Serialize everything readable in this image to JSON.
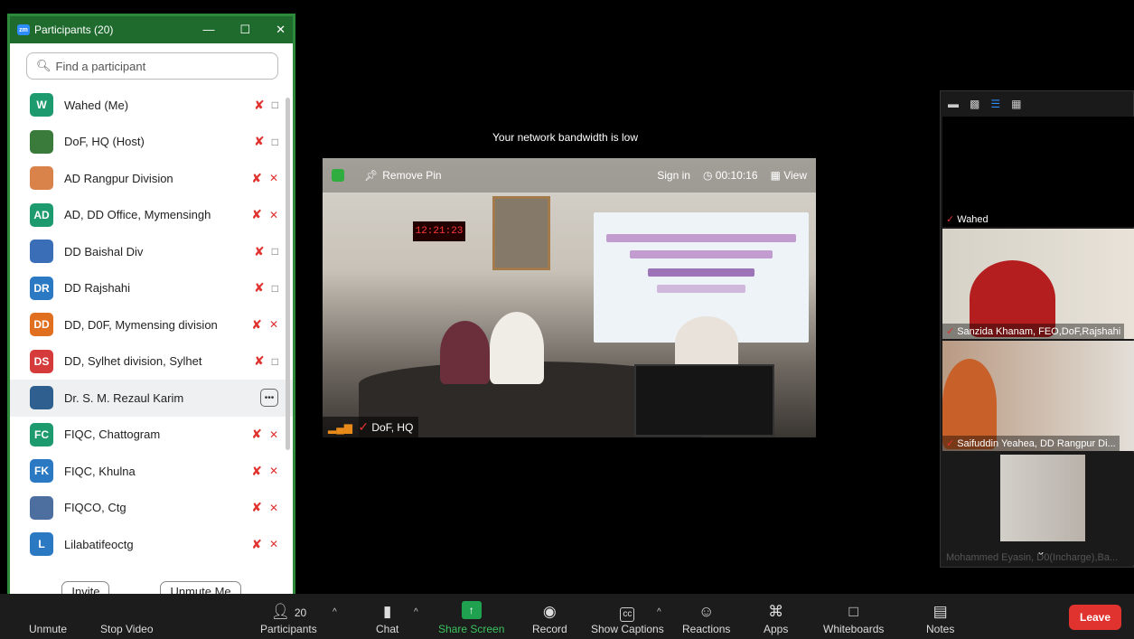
{
  "panel": {
    "title": "Participants (20)",
    "logo": "zm",
    "search_placeholder": "Find a participant",
    "invite_label": "Invite",
    "unmute_me_label": "Unmute Me",
    "participants": [
      {
        "name": "Wahed (Me)",
        "initials": "W",
        "color": "#1e9a6f",
        "mic": "muted",
        "video": "on"
      },
      {
        "name": "DoF, HQ (Host)",
        "initials": "",
        "color": "#3a7a3a",
        "mic": "muted",
        "video": "on"
      },
      {
        "name": "AD Rangpur Division",
        "initials": "",
        "color": "#d9824a",
        "mic": "muted",
        "video": "off"
      },
      {
        "name": "AD, DD Office, Mymensingh",
        "initials": "AD",
        "color": "#1e9a6f",
        "mic": "muted",
        "video": "off"
      },
      {
        "name": "DD Baishal Div",
        "initials": "",
        "color": "#3a6fb7",
        "mic": "muted",
        "video": "on"
      },
      {
        "name": "DD Rajshahi",
        "initials": "DR",
        "color": "#2b79c2",
        "mic": "muted",
        "video": "on"
      },
      {
        "name": "DD, D0F, Mymensing division",
        "initials": "DD",
        "color": "#e07020",
        "mic": "muted",
        "video": "off"
      },
      {
        "name": "DD, Sylhet division, Sylhet",
        "initials": "DS",
        "color": "#d63b3b",
        "mic": "muted",
        "video": "on"
      },
      {
        "name": "Dr. S. M. Rezaul Karim",
        "initials": "",
        "color": "#2f5f8f",
        "mic": "none",
        "video": "more"
      },
      {
        "name": "FIQC, Chattogram",
        "initials": "FC",
        "color": "#1e9a6f",
        "mic": "muted",
        "video": "off"
      },
      {
        "name": "FIQC, Khulna",
        "initials": "FK",
        "color": "#2b79c2",
        "mic": "muted",
        "video": "off"
      },
      {
        "name": "FIQCO, Ctg",
        "initials": "",
        "color": "#4d6f9f",
        "mic": "muted",
        "video": "off"
      },
      {
        "name": "Lilabatifeoctg",
        "initials": "L",
        "color": "#2b79c2",
        "mic": "muted",
        "video": "off"
      }
    ]
  },
  "network_message": "Your network bandwidth is low",
  "main_video": {
    "remove_pin": "Remove Pin",
    "sign_in": "Sign in",
    "timer": "00:10:16",
    "view": "View",
    "speaker_label": "DoF, HQ",
    "clock": "12:21:23"
  },
  "gallery": {
    "tiles": [
      {
        "name": "Wahed"
      },
      {
        "name": "Sanzida Khanam, FEO,DoF,Rajshahi"
      },
      {
        "name": "Saifuddin Yeahea, DD Rangpur Di..."
      },
      {
        "name": "Mohammed Eyasin, D0(Incharge),Ba..."
      }
    ]
  },
  "toolbar": {
    "unmute": "Unmute",
    "stop_video": "Stop Video",
    "participants_count": "20",
    "participants": "Participants",
    "chat": "Chat",
    "share_screen": "Share Screen",
    "record": "Record",
    "show_captions": "Show Captions",
    "captions_badge": "cc",
    "reactions": "Reactions",
    "apps": "Apps",
    "whiteboards": "Whiteboards",
    "notes": "Notes",
    "leave": "Leave"
  },
  "colors": {
    "panel_titlebar": "#1f6b2e",
    "muted_red": "#e0322f",
    "share_green": "#1fa14f",
    "leave_red": "#e0322f"
  }
}
